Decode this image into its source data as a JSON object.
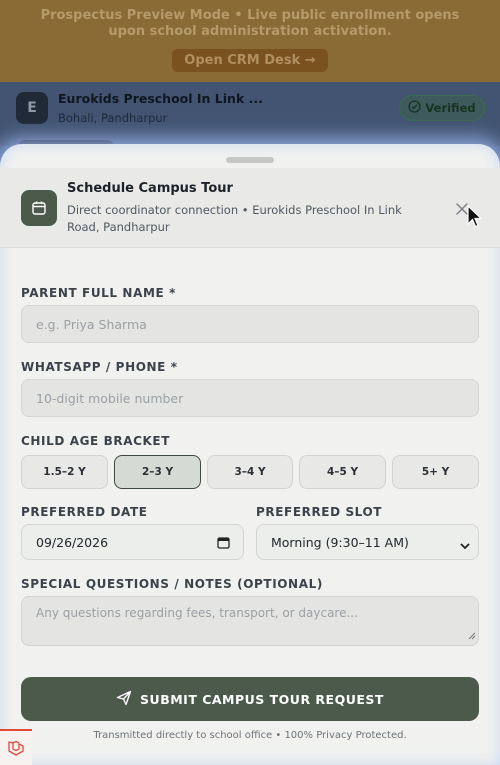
{
  "background": {
    "banner_text": "Prospectus Preview Mode • Live public enrollment opens upon school administration activation.",
    "crm_button": "Open CRM Desk →",
    "school_initial": "E",
    "school_name": "Eurokids Preschool In Link ...",
    "school_place": "Bohali, Pandharpur",
    "verified_badge": "Verified"
  },
  "modal": {
    "title": "Schedule Campus Tour",
    "subtitle": "Direct coordinator connection • Eurokids Preschool In Link Road, Pandharpur",
    "icons": {
      "header": "calendar-icon",
      "close": "close-icon",
      "submit": "send-icon"
    }
  },
  "form": {
    "parent_name": {
      "label": "PARENT FULL NAME *",
      "placeholder": "e.g. Priya Sharma"
    },
    "phone": {
      "label": "WHATSAPP / PHONE *",
      "placeholder": "10-digit mobile number"
    },
    "age": {
      "label": "CHILD AGE BRACKET",
      "options": [
        "1.5–2 Y",
        "2–3 Y",
        "3–4 Y",
        "4–5 Y",
        "5+ Y"
      ],
      "selected": "2–3 Y"
    },
    "date": {
      "label": "PREFERRED DATE",
      "value": "09/26/2026"
    },
    "slot": {
      "label": "PREFERRED SLOT",
      "value": "Morning (9:30–11 AM)"
    },
    "notes": {
      "label": "SPECIAL QUESTIONS / NOTES (OPTIONAL)",
      "placeholder": "Any questions regarding fees, transport, or daycare..."
    },
    "submit_label": "SUBMIT CAMPUS TOUR REQUEST",
    "footer_note": "Transmitted directly to school office • 100% Privacy Protected."
  },
  "colors": {
    "accent": "#4b5a4b",
    "sheet_background": "#f1f2f0",
    "glow": "#96afe6"
  }
}
